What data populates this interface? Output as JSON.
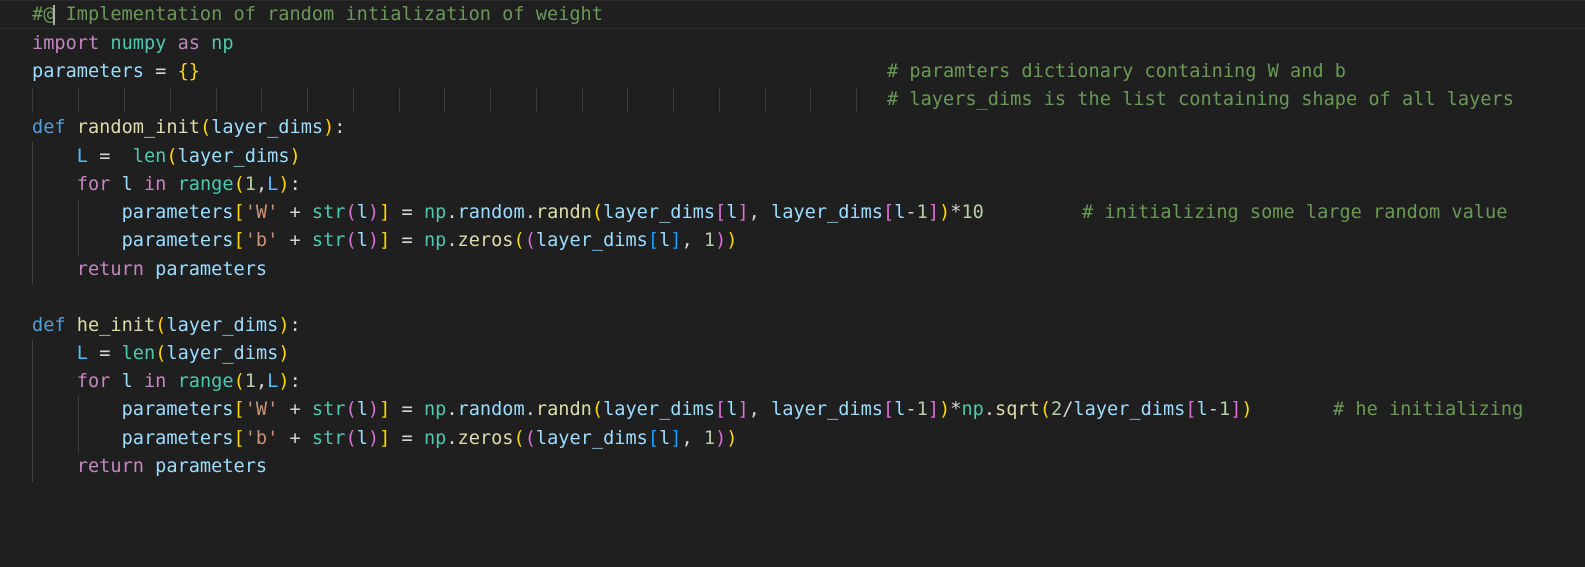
{
  "editor": {
    "language": "python",
    "theme_background": "#1f1f1f",
    "lines": [
      "#@ Implementation of random intialization of weight",
      "import numpy as np",
      "parameters = {}",
      "# paramters dictionary containing W and b",
      "# layers_dims is the list containing shape of all layers",
      "def random_init(layer_dims):",
      "    L =  len(layer_dims)",
      "    for l in range(1,L):",
      "        parameters['W' + str(l)] = np.random.randn(layer_dims[l], layer_dims[l-1])*10",
      "# initializing some large random value",
      "        parameters['b' + str(l)] = np.zeros((layer_dims[l], 1))",
      "    return parameters",
      "def he_init(layer_dims):",
      "    L = len(layer_dims)",
      "    for l in range(1,L):",
      "        parameters['W' + str(l)] = np.random.randn(layer_dims[l], layer_dims[l-1])*np.sqrt(2/layer_dims[l-1])",
      "# he initializing",
      "        parameters['b' + str(l)] = np.zeros((layer_dims[l], 1))",
      "    return parameters"
    ]
  }
}
